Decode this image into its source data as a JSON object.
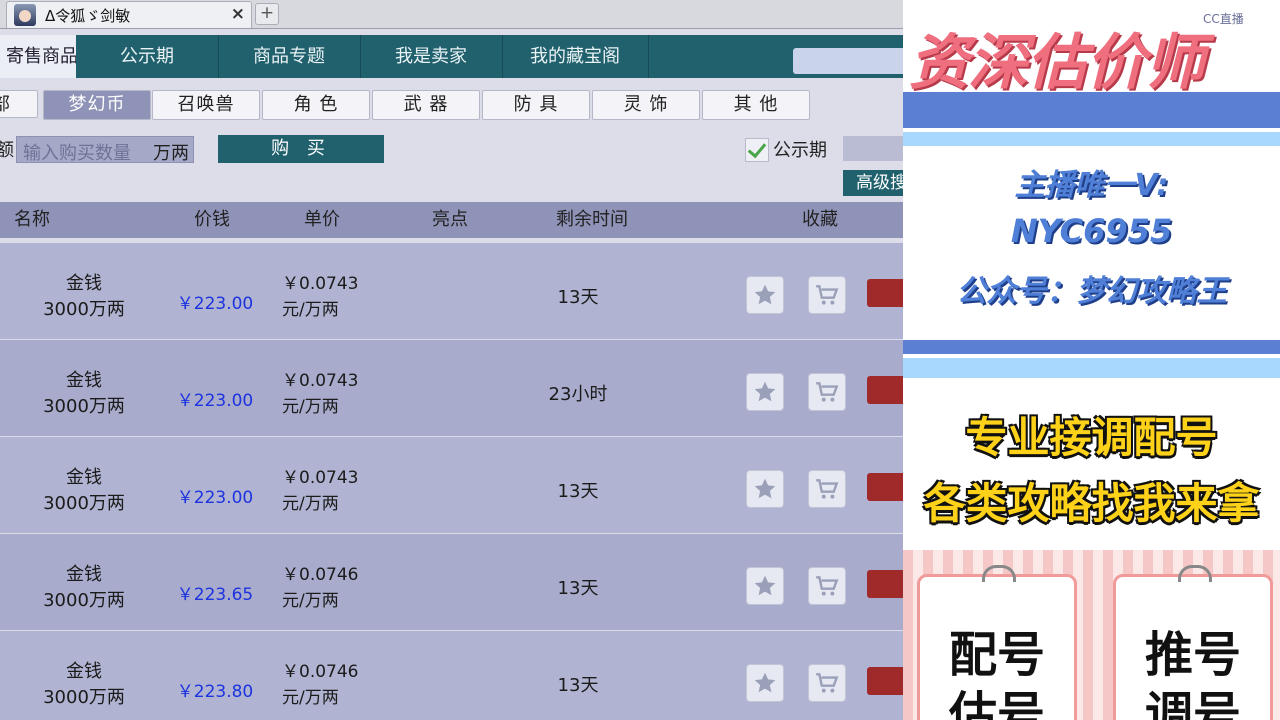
{
  "window": {
    "tab_title": "Δ令狐ゞ剑敏",
    "close": "×",
    "new_tab": "+"
  },
  "nav": {
    "tabs": [
      "寄售商品",
      "公示期",
      "商品专题",
      "我是卖家",
      "我的藏宝阁"
    ]
  },
  "categories": [
    "全部",
    "梦幻币",
    "召唤兽",
    "角 色",
    "武 器",
    "防 具",
    "灵 饰",
    "其 他"
  ],
  "buy": {
    "label_cut": "额",
    "quantity_placeholder": "输入购买数量",
    "unit": "万两",
    "buy_label": "购 买",
    "public_label": "公示期",
    "advanced_label": "高级搜索"
  },
  "table": {
    "headers": [
      "名称",
      "价钱",
      "单价",
      "亮点",
      "剩余时间",
      "收藏"
    ],
    "rows": [
      {
        "name1": "金钱",
        "name2": "3000万两",
        "price": "￥223.00",
        "unit1": "￥0.0743",
        "unit2": "元/万两",
        "time": "13天"
      },
      {
        "name1": "金钱",
        "name2": "3000万两",
        "price": "￥223.00",
        "unit1": "￥0.0743",
        "unit2": "元/万两",
        "time": "23小时"
      },
      {
        "name1": "金钱",
        "name2": "3000万两",
        "price": "￥223.00",
        "unit1": "￥0.0743",
        "unit2": "元/万两",
        "time": "13天"
      },
      {
        "name1": "金钱",
        "name2": "3000万两",
        "price": "￥223.65",
        "unit1": "￥0.0746",
        "unit2": "元/万两",
        "time": "13天"
      },
      {
        "name1": "金钱",
        "name2": "3000万两",
        "price": "￥223.80",
        "unit1": "￥0.0746",
        "unit2": "元/万两",
        "time": "13天"
      }
    ]
  },
  "overlay": {
    "title": "资深估价师",
    "corner_text": "CC直播",
    "line1": "主播唯一V:",
    "line2": "NYC6955",
    "line3": "公众号：梦幻攻略王",
    "yellow1": "专业接调配号",
    "yellow2": "各类攻略找我来拿",
    "card_left": [
      "配号",
      "估号"
    ],
    "card_right": [
      "推号",
      "调号"
    ]
  },
  "colors": {
    "nav": "#21606d",
    "price": "#1c33e0",
    "accent_red": "#a02a2a",
    "overlay_pink": "#ef6f7f",
    "overlay_blue": "#4f7fd6"
  }
}
